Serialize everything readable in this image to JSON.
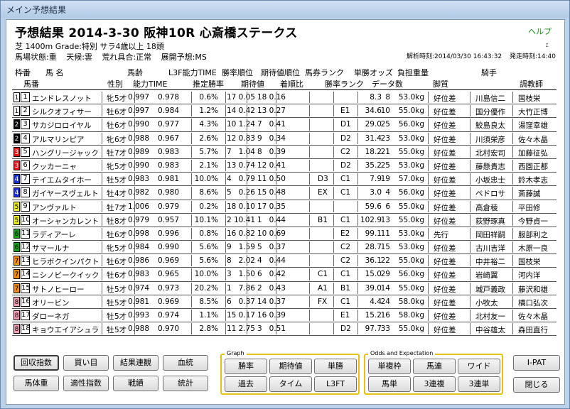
{
  "window": {
    "title": "メイン予想結果"
  },
  "header": {
    "title": "予想結果 2014-3-30 阪神10R 心斎橋ステークス",
    "help": "ヘルプ",
    "race_info": "芝 1400m  Grade:特別 サラ4歳以上 18頭",
    "track_condition": "馬場状態:重",
    "weather": "天候:雲",
    "roughness": "荒れ具合:正常",
    "pace_forecast": "展開予想:MS",
    "analysis_time": "解析時刻:2014/03/30 16:43:32",
    "post_time": "発走時刻:14:40",
    "minimize_glyph": "ｪ"
  },
  "columns_top": {
    "frame": "枠番",
    "horse": "馬 名",
    "age": "馬齢",
    "l3f_ability": "L3F能力TIME",
    "win_rate_rank": "勝率順位",
    "expected_rank": "期待値順位",
    "ticket_rank": "馬券ランク",
    "win_odds": "単勝オッズ",
    "burden": "負担重量",
    "jockey": "騎手"
  },
  "columns_bottom": {
    "number": "馬番",
    "sex": "性別",
    "ability_time": "能力TIME",
    "est_win_rate": "推定勝率",
    "expected_value": "期待値",
    "finish_ratio": "着順比",
    "win_rate_rank": "勝率ランク",
    "data_count": "データ数",
    "running_style": "脚質",
    "trainer": "調教師"
  },
  "frame_colors": [
    "#ffffff",
    "#000000",
    "#e01818",
    "#1830d8",
    "#f0f020",
    "#18a018",
    "#f08c10",
    "#f4a0b4"
  ],
  "rows": [
    {
      "frame": 1,
      "num": "1",
      "name": "エンドレスノット",
      "sex": "牝",
      "age": "5才",
      "ability": "0.997",
      "l3f": "0.978",
      "rate": "0.6%",
      "rr": "17",
      "ev": "0.05",
      "er": "18",
      "fin": "0.16",
      "tr": "",
      "wr": "",
      "odds": "8.3",
      "cnt": "8",
      "wt": "53.0kg",
      "style": "好位差",
      "jockey": "川島信二",
      "trainer": "国枝栄"
    },
    {
      "frame": 1,
      "num": "2",
      "name": "シルクオフィサー",
      "sex": "牡",
      "age": "6才",
      "ability": "0.997",
      "l3f": "0.984",
      "rate": "1.2%",
      "rr": "14",
      "ev": "0.42",
      "er": "13",
      "fin": "0.27",
      "tr": "",
      "wr": "E1",
      "odds": "34.6",
      "cnt": "10",
      "wt": "55.0kg",
      "style": "好位差",
      "jockey": "国分優作",
      "trainer": "大竹正博"
    },
    {
      "frame": 2,
      "num": "3",
      "name": "サカジロロイヤル",
      "sex": "牡",
      "age": "6才",
      "ability": "0.990",
      "l3f": "0.977",
      "rate": "4.3%",
      "rr": "10",
      "ev": "1.24",
      "er": "7",
      "fin": "0.41",
      "tr": "",
      "wr": "D1",
      "odds": "29.0",
      "cnt": "25",
      "wt": "56.0kg",
      "style": "好位差",
      "jockey": "鮫島良太",
      "trainer": "湯窪幸雄"
    },
    {
      "frame": 2,
      "num": "4",
      "name": "アルマリンピア",
      "sex": "牝",
      "age": "6才",
      "ability": "0.988",
      "l3f": "0.967",
      "rate": "2.6%",
      "rr": "12",
      "ev": "0.83",
      "er": "9",
      "fin": "0.34",
      "tr": "",
      "wr": "D2",
      "odds": "31.4",
      "cnt": "23",
      "wt": "53.0kg",
      "style": "好位差",
      "jockey": "川須栄彦",
      "trainer": "佐々木晶"
    },
    {
      "frame": 3,
      "num": "5",
      "name": "ハングリージャック",
      "sex": "牡",
      "age": "7才",
      "ability": "0.989",
      "l3f": "0.983",
      "rate": "5.7%",
      "rr": "7",
      "ev": "1.04",
      "er": "8",
      "fin": "0.39",
      "tr": "",
      "wr": "C2",
      "odds": "18.2",
      "cnt": "21",
      "wt": "55.0kg",
      "style": "好位差",
      "jockey": "北村宏司",
      "trainer": "加藤征弘"
    },
    {
      "frame": 3,
      "num": "6",
      "name": "クッカーニャ",
      "sex": "牝",
      "age": "5才",
      "ability": "0.990",
      "l3f": "0.983",
      "rate": "2.1%",
      "rr": "13",
      "ev": "0.74",
      "er": "12",
      "fin": "0.41",
      "tr": "",
      "wr": "D2",
      "odds": "35.2",
      "cnt": "25",
      "wt": "53.0kg",
      "style": "好位差",
      "jockey": "藤懸貴志",
      "trainer": "西園正都"
    },
    {
      "frame": 4,
      "num": "7",
      "name": "テイエムタイホー",
      "sex": "牡",
      "age": "5才",
      "ability": "0.983",
      "l3f": "0.981",
      "rate": "10.0%",
      "rr": "4",
      "ev": "0.79",
      "er": "11",
      "fin": "0.50",
      "tr": "D3",
      "wr": "C1",
      "odds": "7.9",
      "cnt": "19",
      "wt": "57.0kg",
      "style": "好位差",
      "jockey": "小坂忠士",
      "trainer": "鈴木孝志"
    },
    {
      "frame": 4,
      "num": "8",
      "name": "ガイヤースヴェルト",
      "sex": "牡",
      "age": "4才",
      "ability": "0.982",
      "l3f": "0.980",
      "rate": "8.6%",
      "rr": "5",
      "ev": "0.26",
      "er": "15",
      "fin": "0.48",
      "tr": "EX",
      "wr": "C1",
      "odds": "3.0",
      "cnt": "4",
      "wt": "56.0kg",
      "style": "好位差",
      "jockey": "ペドロサ",
      "trainer": "斎藤誠"
    },
    {
      "frame": 5,
      "num": "9",
      "name": "アンヴァルト",
      "sex": "牡",
      "age": "7才",
      "ability": "1.006",
      "l3f": "0.979",
      "rate": "0.2%",
      "rr": "18",
      "ev": "0.10",
      "er": "17",
      "fin": "0.35",
      "tr": "",
      "wr": "",
      "odds": "59.6",
      "cnt": "6",
      "wt": "55.0kg",
      "style": "好位差",
      "jockey": "高倉稜",
      "trainer": "平田修"
    },
    {
      "frame": 5,
      "num": "10",
      "name": "オーシャンカレント",
      "sex": "牡",
      "age": "8才",
      "ability": "0.979",
      "l3f": "0.957",
      "rate": "10.1%",
      "rr": "2",
      "ev": "10.41",
      "er": "1",
      "fin": "0.44",
      "tr": "B1",
      "wr": "C1",
      "odds": "102.9",
      "cnt": "13",
      "wt": "55.0kg",
      "style": "好位差",
      "jockey": "荻野琢真",
      "trainer": "今野貞一"
    },
    {
      "frame": 6,
      "num": "11",
      "name": "ラディアーレ",
      "sex": "牡",
      "age": "6才",
      "ability": "0.998",
      "l3f": "0.996",
      "rate": "0.8%",
      "rr": "16",
      "ev": "0.82",
      "er": "10",
      "fin": "0.69",
      "tr": "",
      "wr": "E2",
      "odds": "99.1",
      "cnt": "11",
      "wt": "53.0kg",
      "style": "先行",
      "jockey": "岡田祥嗣",
      "trainer": "服部利之"
    },
    {
      "frame": 6,
      "num": "12",
      "name": "サマールナ",
      "sex": "牝",
      "age": "5才",
      "ability": "0.984",
      "l3f": "0.990",
      "rate": "5.6%",
      "rr": "9",
      "ev": "1.59",
      "er": "5",
      "fin": "0.37",
      "tr": "",
      "wr": "C2",
      "odds": "28.7",
      "cnt": "15",
      "wt": "53.0kg",
      "style": "好位差",
      "jockey": "古川吉洋",
      "trainer": "木原一良"
    },
    {
      "frame": 7,
      "num": "13",
      "name": "ヒラボクインパクト",
      "sex": "牡",
      "age": "6才",
      "ability": "0.986",
      "l3f": "0.969",
      "rate": "5.6%",
      "rr": "8",
      "ev": "2.02",
      "er": "4",
      "fin": "0.44",
      "tr": "",
      "wr": "C2",
      "odds": "36.1",
      "cnt": "22",
      "wt": "55.0kg",
      "style": "好位差",
      "jockey": "中井裕二",
      "trainer": "国枝栄"
    },
    {
      "frame": 7,
      "num": "14",
      "name": "ニシノビークイック",
      "sex": "牡",
      "age": "6才",
      "ability": "0.983",
      "l3f": "0.965",
      "rate": "10.0%",
      "rr": "3",
      "ev": "1.50",
      "er": "6",
      "fin": "0.42",
      "tr": "C1",
      "wr": "C1",
      "odds": "15.0",
      "cnt": "29",
      "wt": "56.0kg",
      "style": "好位差",
      "jockey": "岩崎翼",
      "trainer": "河内洋"
    },
    {
      "frame": 7,
      "num": "15",
      "name": "サトノヒーロー",
      "sex": "牡",
      "age": "5才",
      "ability": "0.974",
      "l3f": "0.973",
      "rate": "20.2%",
      "rr": "1",
      "ev": "7.86",
      "er": "2",
      "fin": "0.43",
      "tr": "A1",
      "wr": "B1",
      "odds": "39.0",
      "cnt": "14",
      "wt": "55.0kg",
      "style": "好位差",
      "jockey": "城戸義政",
      "trainer": "藤沢和雄"
    },
    {
      "frame": 8,
      "num": "16",
      "name": "オリービン",
      "sex": "牡",
      "age": "5才",
      "ability": "0.981",
      "l3f": "0.969",
      "rate": "8.5%",
      "rr": "6",
      "ev": "0.37",
      "er": "14",
      "fin": "0.37",
      "tr": "FX",
      "wr": "C1",
      "odds": "4.4",
      "cnt": "24",
      "wt": "58.0kg",
      "style": "好位差",
      "jockey": "小牧太",
      "trainer": "橋口弘次"
    },
    {
      "frame": 8,
      "num": "17",
      "name": "ダローネガ",
      "sex": "牡",
      "age": "5才",
      "ability": "0.993",
      "l3f": "0.974",
      "rate": "1.1%",
      "rr": "15",
      "ev": "0.17",
      "er": "16",
      "fin": "0.39",
      "tr": "",
      "wr": "E1",
      "odds": "15.2",
      "cnt": "16",
      "wt": "58.0kg",
      "style": "好位差",
      "jockey": "北村友一",
      "trainer": "佐々木晶"
    },
    {
      "frame": 8,
      "num": "18",
      "name": "キョウエイアシュラ",
      "sex": "牡",
      "age": "5才",
      "ability": "0.988",
      "l3f": "0.970",
      "rate": "2.8%",
      "rr": "11",
      "ev": "2.75",
      "er": "3",
      "fin": "0.51",
      "tr": "",
      "wr": "D2",
      "odds": "97.7",
      "cnt": "33",
      "wt": "55.0kg",
      "style": "好位差",
      "jockey": "中谷雄太",
      "trainer": "森田直行"
    }
  ],
  "buttons": {
    "recovery_index": "回収指数",
    "bet_target": "買い目",
    "result_sequence": "結果連観",
    "bloodline": "血統",
    "horse_weight": "馬体重",
    "aptitude_index": "適性指数",
    "record": "戦績",
    "statistics": "統計",
    "ipat": "I-PAT",
    "close": "閉じる"
  },
  "graph_group": {
    "label": "Graph",
    "win_rate": "勝率",
    "expected_value": "期待値",
    "win_single": "単勝",
    "past": "過去",
    "time": "タイム",
    "l3ft": "L3FT"
  },
  "odds_group": {
    "label": "Odds and Expectation",
    "bracket_quinella": "単複枠",
    "quinella": "馬連",
    "wide": "ワイド",
    "exacta": "馬単",
    "trio": "3連複",
    "trifecta": "3連単"
  }
}
